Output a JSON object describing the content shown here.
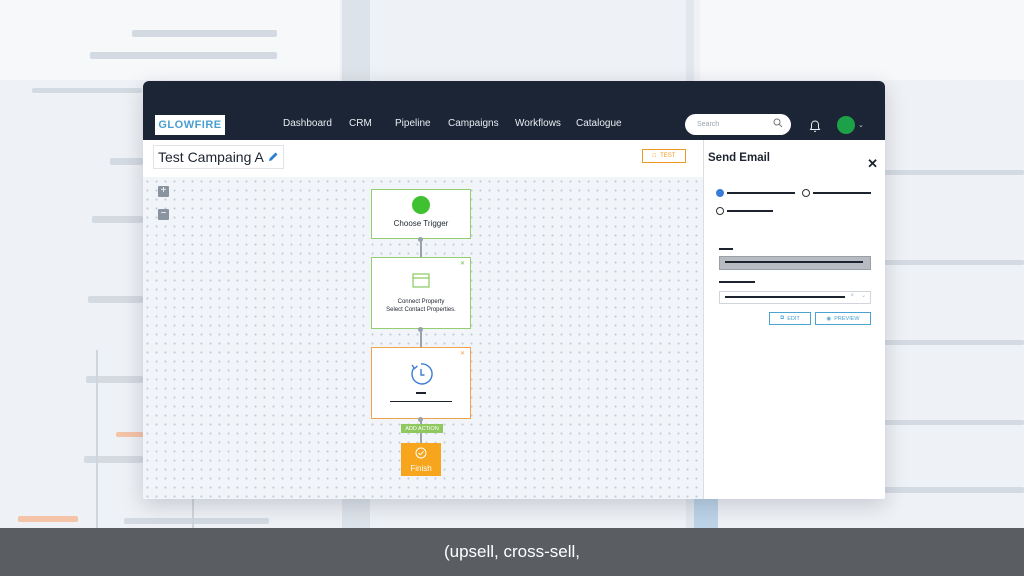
{
  "app": {
    "logo_text": "GLOWFIRE"
  },
  "nav": {
    "items": [
      "Dashboard",
      "CRM",
      "Pipeline",
      "Campaigns",
      "Workflows",
      "Catalogue"
    ]
  },
  "search": {
    "placeholder": "Search"
  },
  "campaign": {
    "title": "Test Campaing A",
    "test_button": "TEST"
  },
  "workflow": {
    "trigger_label": "Choose Trigger",
    "connect_line1": "Connect Property",
    "connect_line2": "Select Contact Properties.",
    "add_action_label": "ADD ACTION",
    "finish_label": "Finish"
  },
  "side_panel": {
    "title": "Send Email",
    "close_symbol": "✕",
    "edit_button": "EDIT",
    "preview_button": "PREVIEW"
  },
  "caption": {
    "text": "(upsell, cross-sell,"
  },
  "colors": {
    "topbar": "#1c2535",
    "node_green": "#93cf6e",
    "node_orange": "#f2a24a",
    "finish": "#f7a51d",
    "accent_blue": "#4aa3d0"
  }
}
